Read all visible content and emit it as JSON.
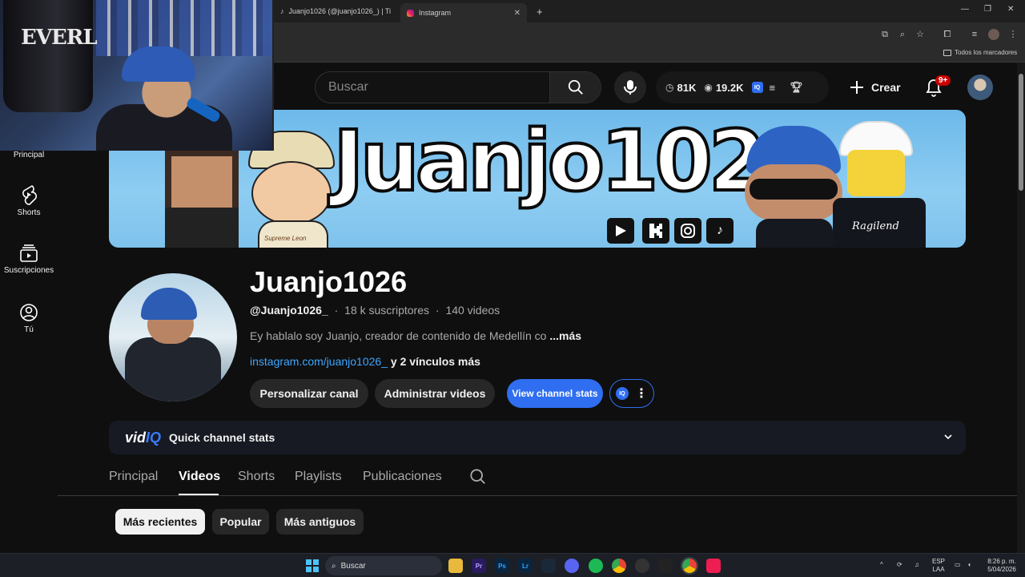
{
  "browser": {
    "tabs": [
      {
        "title": "Juanjo1026 (@juanjo1026_) | Ti"
      },
      {
        "title": "Instagram"
      }
    ],
    "bookmarks_label": "Todos los marcadores"
  },
  "webcam": {
    "bag_text": "EVERL"
  },
  "header": {
    "search_placeholder": "Buscar",
    "stats": {
      "subs": "81K",
      "views": "19.2K"
    },
    "create_label": "Crear",
    "notif_badge": "9+"
  },
  "sidebar": {
    "items": [
      {
        "label": "Principal"
      },
      {
        "label": "Shorts"
      },
      {
        "label": "Suscripciones"
      },
      {
        "label": "Tú"
      }
    ]
  },
  "banner": {
    "title": "Juanjo1026",
    "cartoon_label": "Supreme Leon",
    "lego_label": "Ragilend"
  },
  "channel": {
    "name": "Juanjo1026",
    "handle": "@Juanjo1026_",
    "subscribers": "18 k suscriptores",
    "videos": "140 videos",
    "description": "Ey hablalo soy Juanjo, creador de contenido de Medellín co",
    "more_label": "...más",
    "link": "instagram.com/juanjo1026_",
    "extra_links": "y 2 vínculos más",
    "buttons": {
      "customize": "Personalizar canal",
      "manage": "Administrar videos",
      "stats": "View channel stats"
    }
  },
  "vidiq": {
    "logo_vid": "vid",
    "logo_iq": "IQ",
    "title": "Quick channel stats"
  },
  "tabs": [
    {
      "label": "Principal",
      "active": false
    },
    {
      "label": "Videos",
      "active": true
    },
    {
      "label": "Shorts",
      "active": false
    },
    {
      "label": "Playlists",
      "active": false
    },
    {
      "label": "Publicaciones",
      "active": false
    }
  ],
  "chips": [
    {
      "label": "Más recientes",
      "active": true
    },
    {
      "label": "Popular",
      "active": false
    },
    {
      "label": "Más antiguos",
      "active": false
    }
  ],
  "taskbar": {
    "search_label": "Buscar",
    "lang_top": "ESP",
    "lang_bottom": "LAA",
    "time": "8:26 p. m.",
    "date": "5/04/2026",
    "apps": [
      "Pr",
      "Ps",
      "Lr"
    ]
  },
  "colors": {
    "accent_blue": "#3ea6ff",
    "vidiq_blue": "#2f6ef0",
    "badge_red": "#cc0000"
  }
}
